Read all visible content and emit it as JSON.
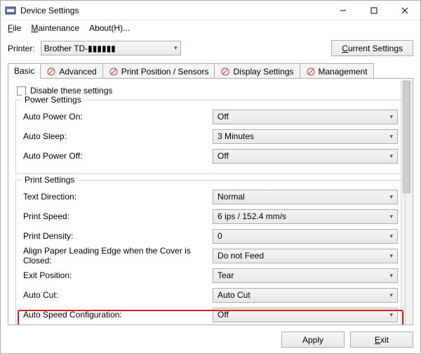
{
  "titlebar": {
    "title": "Device Settings"
  },
  "menubar": {
    "file": "File",
    "maintenance": "Maintenance",
    "about": "About(H)..."
  },
  "toprow": {
    "printer_label": "Printer:",
    "printer_value": "Brother TD-▮▮▮▮▮▮",
    "current_settings": "Current Settings"
  },
  "tabs": {
    "basic": "Basic",
    "advanced": "Advanced",
    "print_position": "Print Position / Sensors",
    "display": "Display Settings",
    "management": "Management"
  },
  "panel": {
    "disable_label": "Disable these settings",
    "power_group": "Power Settings",
    "auto_power_on_label": "Auto Power On:",
    "auto_power_on_value": "Off",
    "auto_sleep_label": "Auto Sleep:",
    "auto_sleep_value": "3 Minutes",
    "auto_power_off_label": "Auto Power Off:",
    "auto_power_off_value": "Off",
    "print_group": "Print Settings",
    "text_direction_label": "Text Direction:",
    "text_direction_value": "Normal",
    "print_speed_label": "Print Speed:",
    "print_speed_value": "6 ips / 152.4 mm/s",
    "print_density_label": "Print Density:",
    "print_density_value": "0",
    "align_label": "Align Paper Leading Edge when the Cover is Closed:",
    "align_value": "Do not Feed",
    "exit_pos_label": "Exit Position:",
    "exit_pos_value": "Tear",
    "auto_cut_label": "Auto Cut:",
    "auto_cut_value": "Auto Cut",
    "auto_speed_label": "Auto Speed Configuration:",
    "auto_speed_value": "Off"
  },
  "footer": {
    "apply": "Apply",
    "exit": "Exit"
  }
}
